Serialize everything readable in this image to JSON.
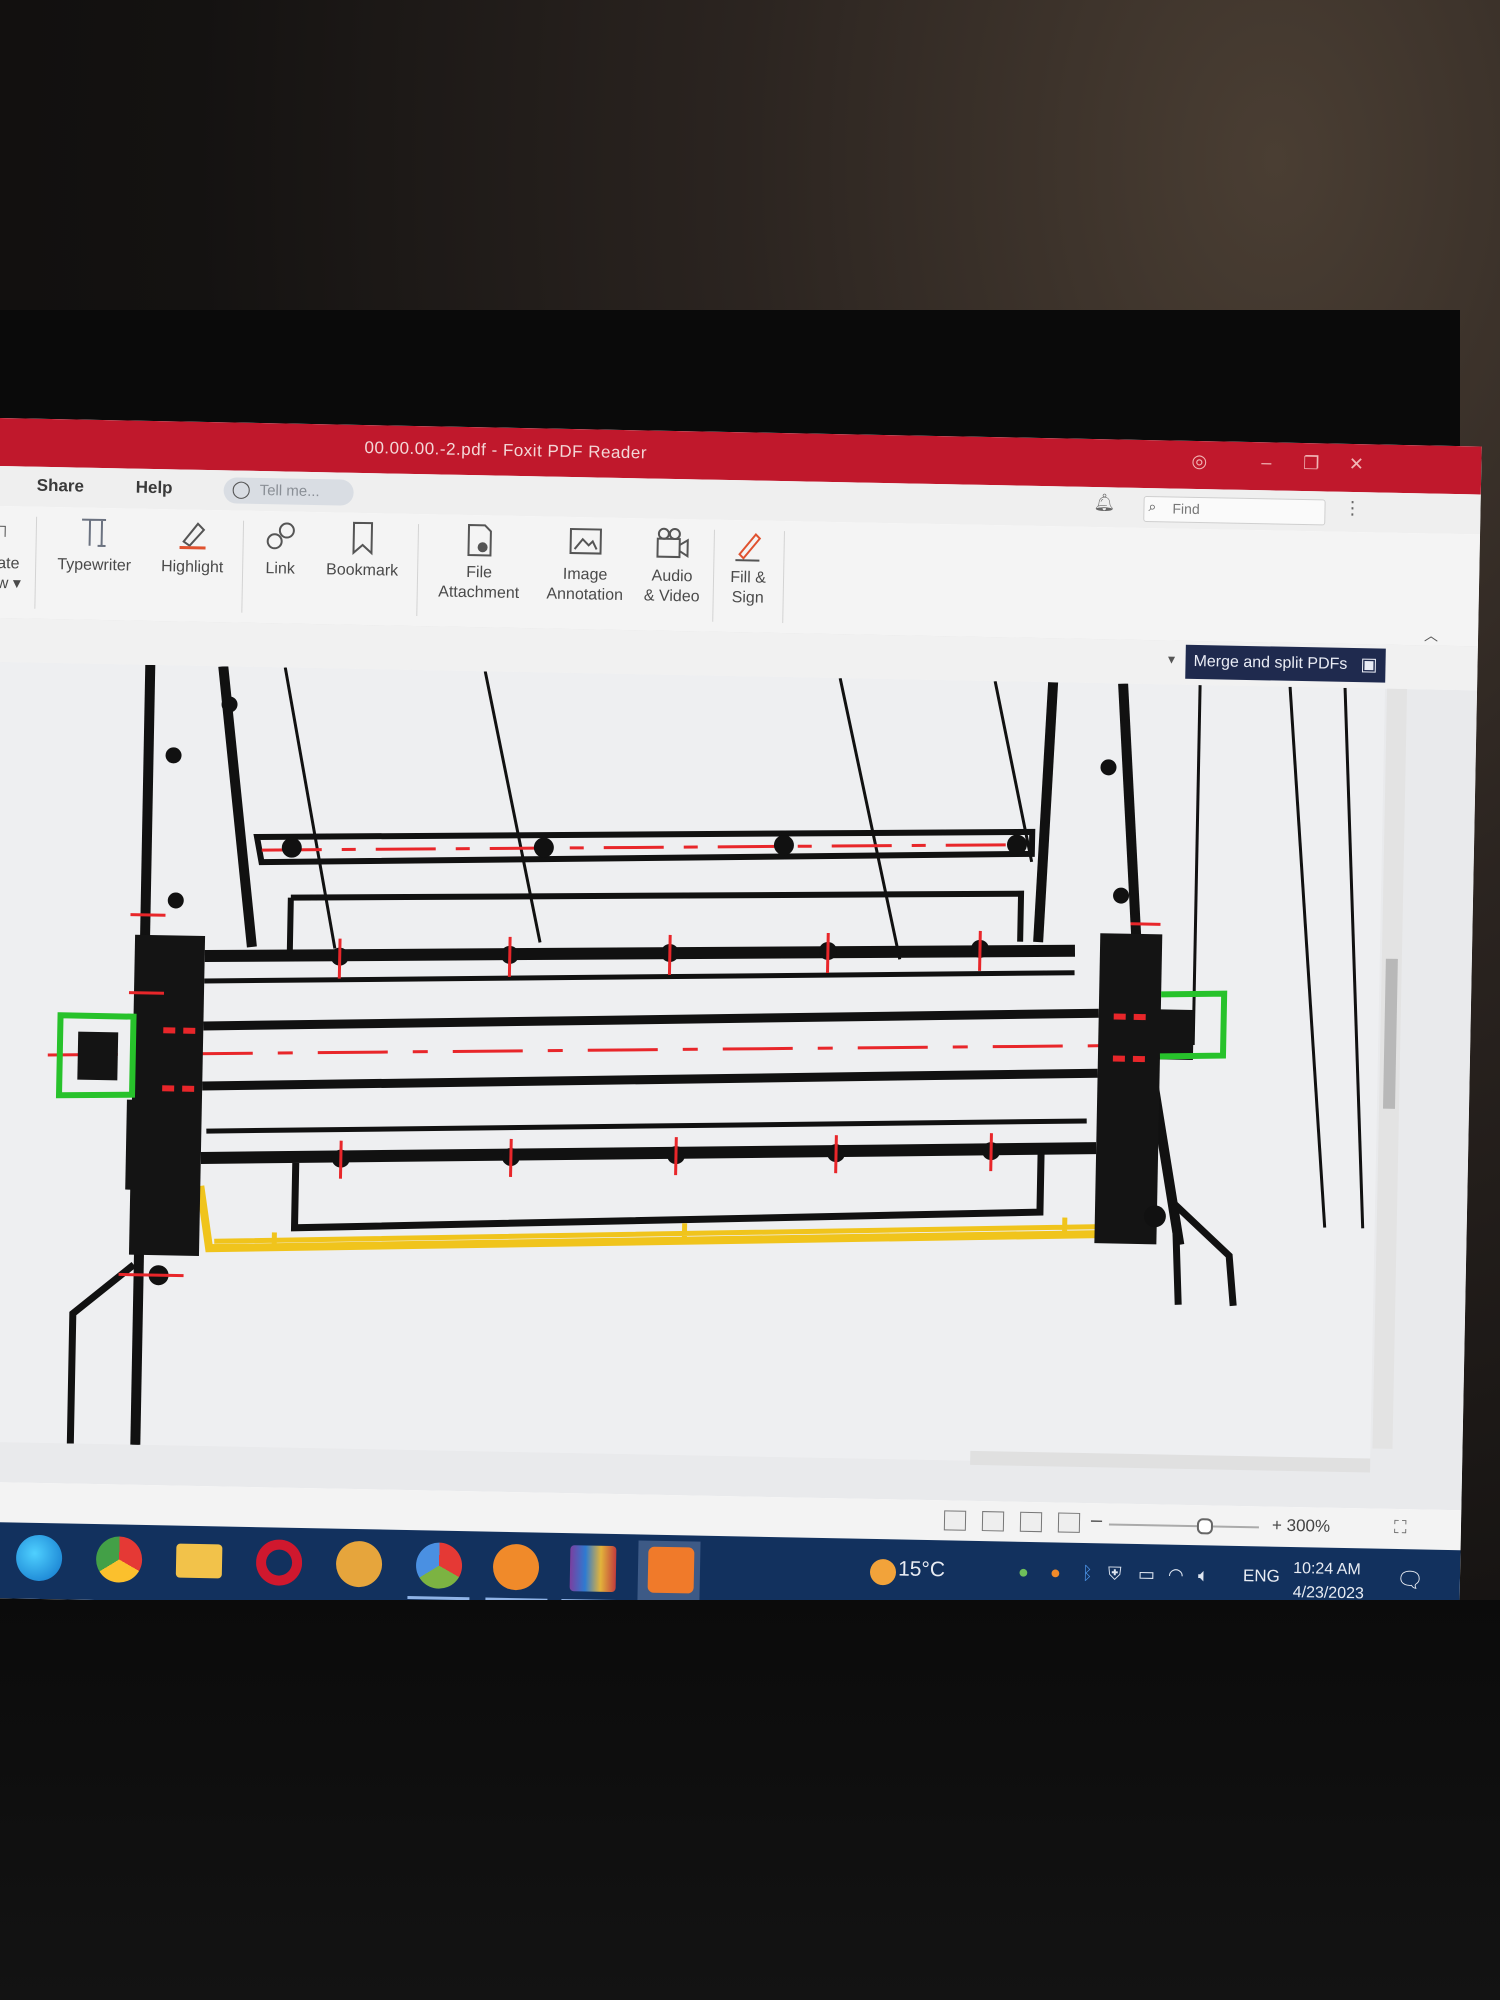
{
  "window": {
    "title": "00.00.00.-2.pdf - Foxit PDF Reader"
  },
  "menu": {
    "items": [
      "Share",
      "Help"
    ],
    "tell_me": "Tell me...",
    "find_placeholder": "Find"
  },
  "ribbon": {
    "partial_left_top": "ate",
    "partial_left_bottom": "w ▾",
    "buttons": [
      {
        "label_1": "Typewriter",
        "label_2": "",
        "icon": "typewriter-icon"
      },
      {
        "label_1": "Highlight",
        "label_2": "",
        "icon": "highlight-icon"
      },
      {
        "label_1": "Link",
        "label_2": "",
        "icon": "link-icon"
      },
      {
        "label_1": "Bookmark",
        "label_2": "",
        "icon": "bookmark-icon"
      },
      {
        "label_1": "File",
        "label_2": "Attachment",
        "icon": "file-attachment-icon"
      },
      {
        "label_1": "Image",
        "label_2": "Annotation",
        "icon": "image-annotation-icon"
      },
      {
        "label_1": "Audio",
        "label_2": "& Video",
        "icon": "audio-video-icon"
      },
      {
        "label_1": "Fill &",
        "label_2": "Sign",
        "icon": "fill-sign-icon"
      }
    ]
  },
  "toolbar": {
    "merge_label": "Merge and split PDFs"
  },
  "status": {
    "zoom": "300%",
    "zoom_fraction": 0.63
  },
  "taskbar": {
    "apps": [
      "edge-icon",
      "chrome-icon",
      "file-explorer-icon",
      "opera-icon",
      "vpn-icon",
      "chrome-alt-icon",
      "avast-icon",
      "winrar-icon",
      "foxit-pdf-icon"
    ],
    "weather": "15°C",
    "language": "ENG",
    "time": "10:24 AM",
    "date": "4/23/2023"
  },
  "colors": {
    "titlebar": "#c0182c",
    "taskbar": "#12315e",
    "merge_banner": "#1f2a4e",
    "drawing_red": "#e8262a",
    "drawing_green": "#27c22b",
    "drawing_yellow": "#f0c41c"
  }
}
